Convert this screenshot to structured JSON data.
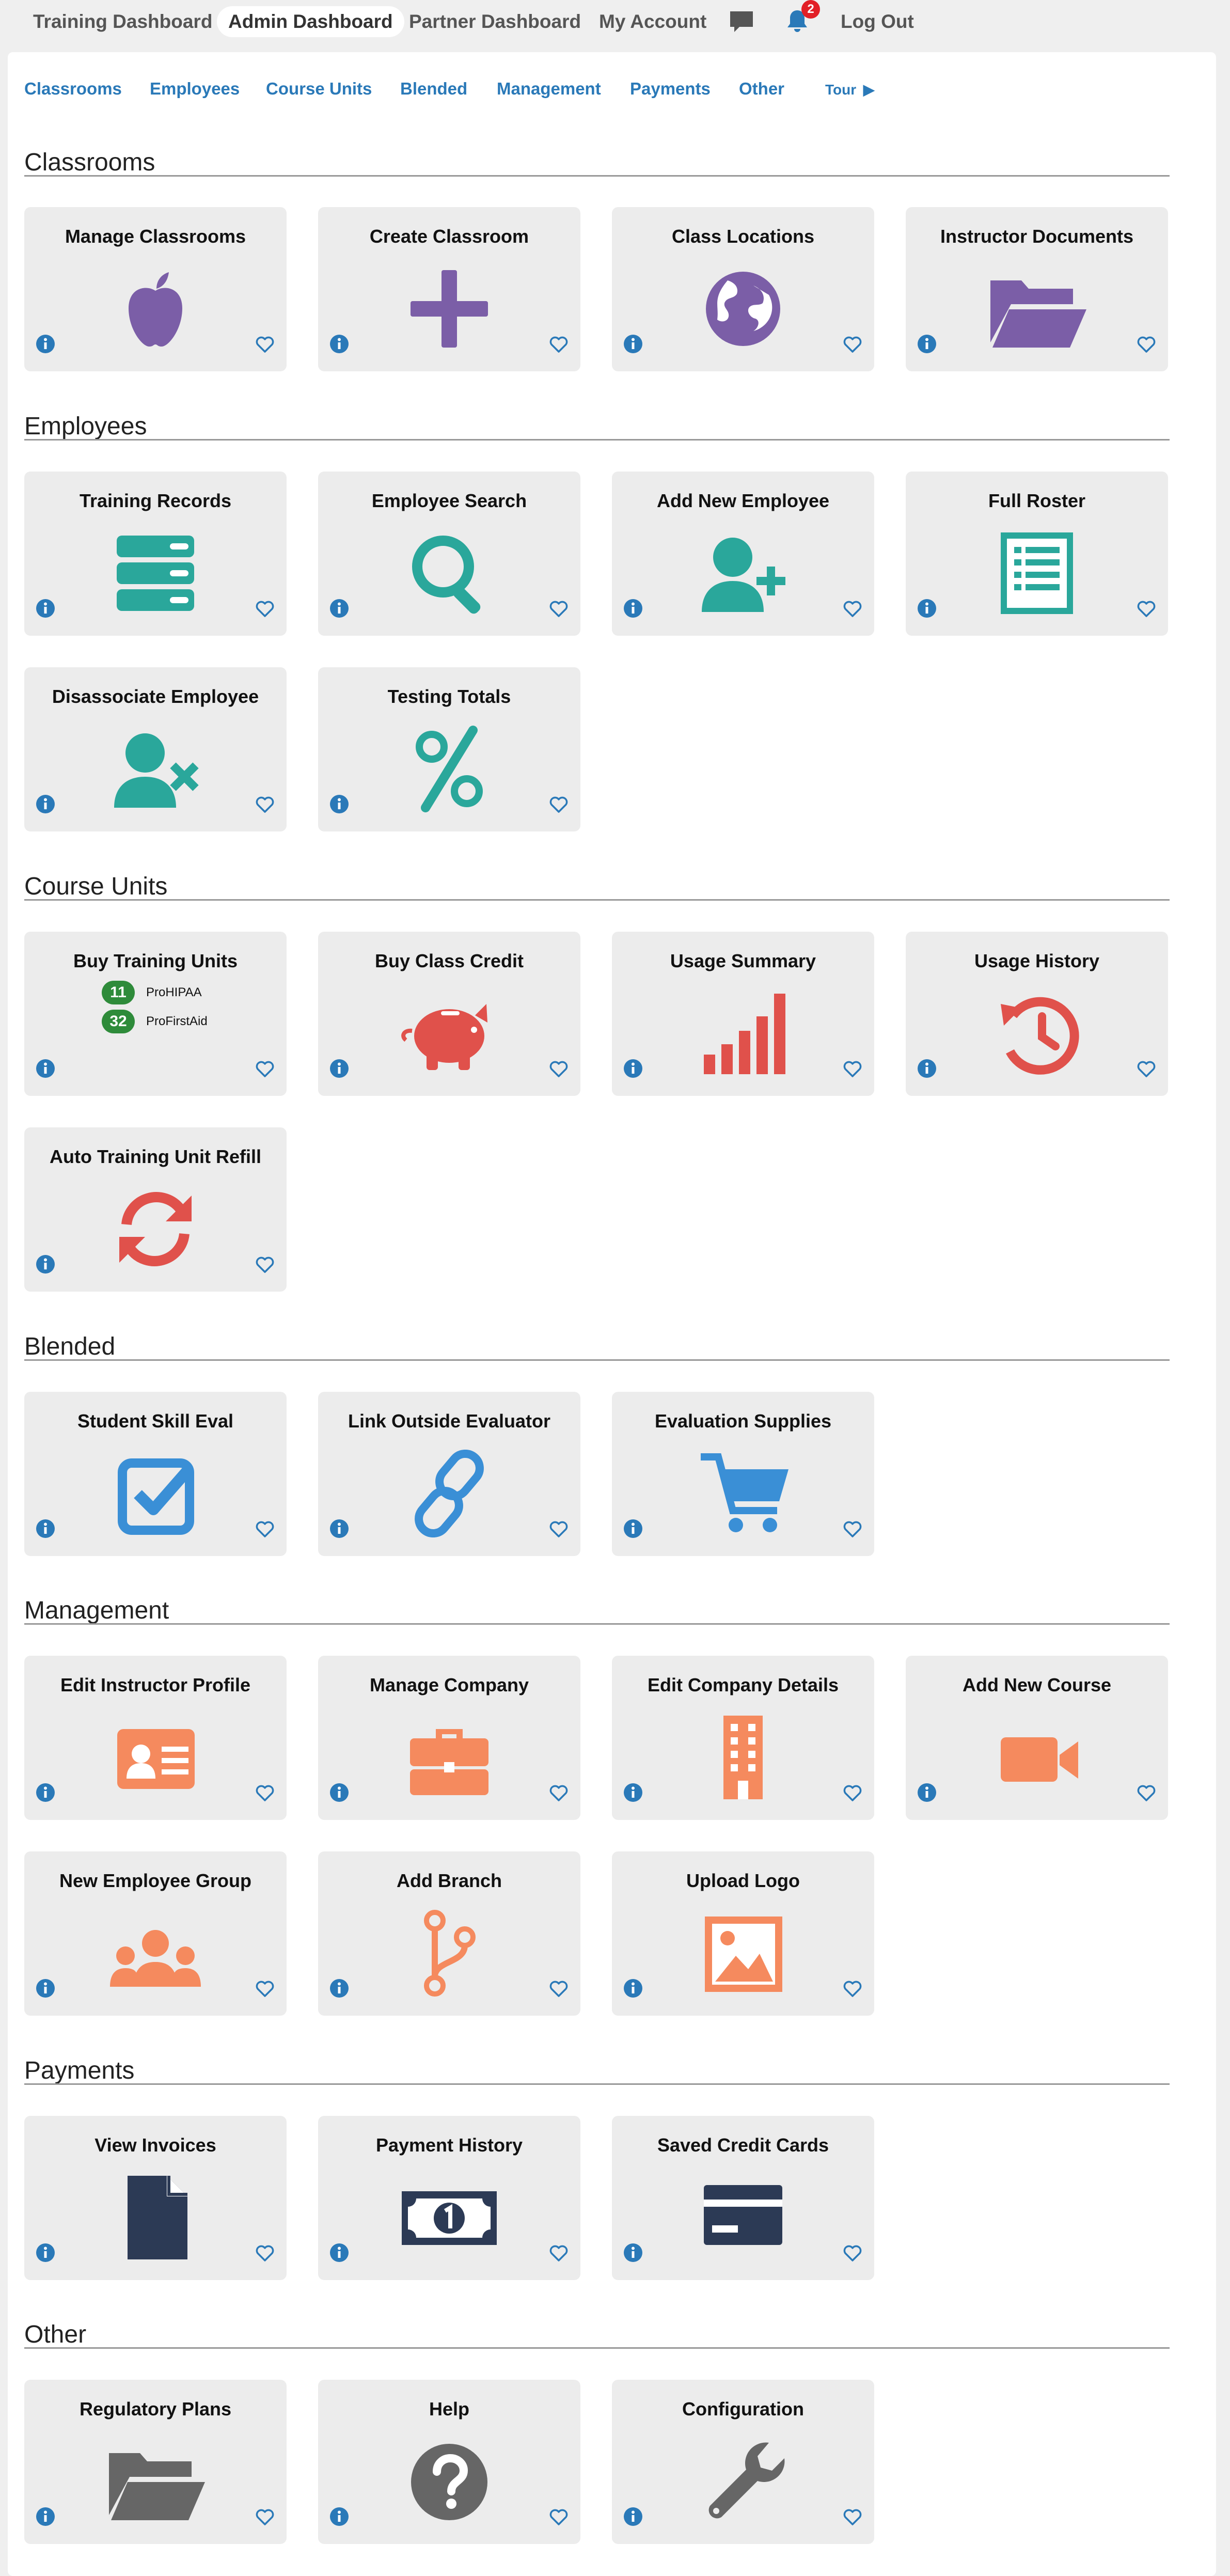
{
  "topnav": {
    "training": "Training Dashboard",
    "admin": "Admin Dashboard",
    "partner": "Partner Dashboard",
    "account": "My Account",
    "notifications": "2",
    "logout": "Log Out"
  },
  "subnav": {
    "classrooms": "Classrooms",
    "employees": "Employees",
    "course_units": "Course Units",
    "blended": "Blended",
    "management": "Management",
    "payments": "Payments",
    "other": "Other",
    "tour": "Tour"
  },
  "sections": {
    "classrooms": {
      "title": "Classrooms",
      "cards": [
        "Manage Classrooms",
        "Create Classroom",
        "Class Locations",
        "Instructor Documents"
      ]
    },
    "employees": {
      "title": "Employees",
      "cards": [
        "Training Records",
        "Employee Search",
        "Add New Employee",
        "Full Roster",
        "Disassociate Employee",
        "Testing Totals"
      ]
    },
    "course_units": {
      "title": "Course Units",
      "cards": [
        "Buy Training Units",
        "Buy Class Credit",
        "Usage Summary",
        "Usage History",
        "Auto Training Unit Refill"
      ],
      "units": [
        {
          "count": "11",
          "name": "ProHIPAA"
        },
        {
          "count": "32",
          "name": "ProFirstAid"
        }
      ]
    },
    "blended": {
      "title": "Blended",
      "cards": [
        "Student Skill Eval",
        "Link Outside Evaluator",
        "Evaluation Supplies"
      ]
    },
    "management": {
      "title": "Management",
      "cards": [
        "Edit Instructor Profile",
        "Manage Company",
        "Edit Company Details",
        "Add New Course",
        "New Employee Group",
        "Add Branch",
        "Upload Logo"
      ]
    },
    "payments": {
      "title": "Payments",
      "cards": [
        "View Invoices",
        "Payment History",
        "Saved Credit Cards"
      ]
    },
    "other": {
      "title": "Other",
      "cards": [
        "Regulatory Plans",
        "Help",
        "Configuration"
      ]
    }
  },
  "colors": {
    "link": "#2a79b8",
    "classrooms": "#7b5ea7",
    "employees": "#2aa79b",
    "course_units": "#e0514b",
    "blended": "#3a8fd6",
    "management": "#f58a5e",
    "payments": "#2c3a55",
    "other": "#666666",
    "badge": "#e21f26",
    "unit_pill": "#2e8b3a"
  }
}
